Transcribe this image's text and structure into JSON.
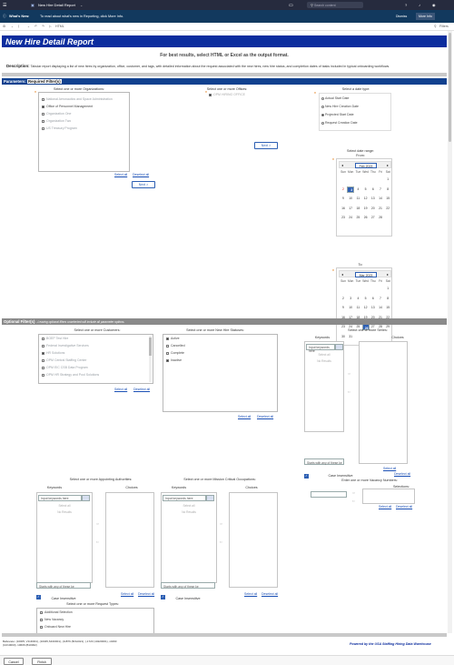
{
  "topbar": {
    "doc_title": "New Hire Detail Report",
    "search_placeholder": "Search content"
  },
  "banner": {
    "label": "What's New:",
    "text": "To read about what's new in Reporting, click More Info.",
    "dismiss": "Dismiss",
    "more": "More Info"
  },
  "toolbar": {
    "html": "HTML",
    "filters": "Filters"
  },
  "report": {
    "title": "New Hire Detail Report",
    "note": "For best results, select HTML or Excel as the output format.",
    "desc_label": "Description:",
    "desc_text": "Tabular report displaying a list of new hires by organization, office, customer, and tags, with detailed information about the request associated with the new hires, new hire status, and completion dates of tasks included in typical onboarding workflows."
  },
  "params": {
    "label": "Parameters:",
    "required": "Required Filter(s)"
  },
  "orgs": {
    "caption": "Select one or more Organizations:",
    "items": [
      "National Aeronautics and Space Administration",
      "Office of Personnel Management",
      "Organization One",
      "Organization Two",
      "US Treasury Program"
    ],
    "select_all": "Select all",
    "deselect_all": "Deselect all",
    "next": "Next >"
  },
  "offices": {
    "caption": "Select one or more Offices:",
    "item": "OPM HIRING OFFICE",
    "next": "Next >"
  },
  "datetype": {
    "caption": "Select a date type:",
    "options": [
      "Actual Start Date",
      "New Hire Creation Date",
      "Projected Start Date",
      "Request Creation Date"
    ],
    "range": "Select date range:",
    "from": "From:",
    "to": "To:"
  },
  "cal_weekdays": [
    "Sun",
    "Mon",
    "Tue",
    "Wed",
    "Thu",
    "Fri",
    "Sat"
  ],
  "cal_from": {
    "month": "Feb 2023",
    "rows": [
      [
        "",
        "",
        "",
        "1",
        "2",
        "3",
        "4"
      ],
      [
        "5",
        "6",
        "7",
        "8",
        "9",
        "10",
        "11"
      ],
      [
        "12",
        "13",
        "14",
        "15",
        "16",
        "17",
        "18"
      ],
      [
        "19",
        "20",
        "21",
        "22",
        "23",
        "24",
        "25"
      ],
      [
        "26",
        "27",
        "28",
        "",
        "",
        "",
        ""
      ]
    ]
  },
  "cal_to": {
    "month": "Mar 2023",
    "rows": [
      [
        "",
        "",
        "",
        "1",
        "2",
        "3",
        "4"
      ],
      [
        "5",
        "6",
        "7",
        "8",
        "9",
        "10",
        "11"
      ],
      [
        "12",
        "13",
        "14",
        "15",
        "16",
        "17",
        "18"
      ],
      [
        "19",
        "20",
        "21",
        "22",
        "23",
        "24",
        "25"
      ],
      [
        "26",
        "27",
        "28",
        "29",
        "30",
        "31",
        ""
      ]
    ]
  },
  "cal_from_disp": {
    "month": "Feb 2023",
    "rows": [
      [
        "",
        "",
        "",
        "",
        "",
        "",
        "1"
      ],
      [
        "2",
        "3",
        "4",
        "5",
        "6",
        "7",
        "8"
      ],
      [
        "9",
        "10",
        "11",
        "12",
        "13",
        "14",
        "15"
      ],
      [
        "16",
        "17",
        "18",
        "19",
        "20",
        "21",
        "22"
      ],
      [
        "23",
        "24",
        "25",
        "26",
        "27",
        "28",
        ""
      ]
    ]
  },
  "cal_to_disp": {
    "month": "Mar 2023",
    "rows": [
      [
        "",
        "",
        "",
        "",
        "",
        "",
        "1"
      ],
      [
        "2",
        "3",
        "4",
        "5",
        "6",
        "7",
        "8"
      ],
      [
        "9",
        "10",
        "11",
        "12",
        "13",
        "14",
        "15"
      ],
      [
        "16",
        "17",
        "18",
        "19",
        "20",
        "21",
        "22"
      ],
      [
        "23",
        "24",
        "25",
        "26",
        "27",
        "28",
        "29"
      ],
      [
        "30",
        "31",
        "",
        "",
        "",
        "",
        ""
      ]
    ]
  },
  "optional": {
    "label": "Optional Filter(s)",
    "note": "- Leaving optional filters unselected will include all parameter options."
  },
  "customers": {
    "caption": "Select one or more Customers:",
    "items": [
      "BOEP Test Hire",
      "Federal Investigative Services",
      "HR Solutions",
      "OPM Central Staffing Center",
      "OPM EIC CSB Data Program",
      "OPM HR Strategy and Pool Solutions"
    ],
    "select_all": "Select all",
    "deselect_all": "Deselect all"
  },
  "statuses": {
    "caption": "Select one or more New Hire Statuses:",
    "items": [
      "Active",
      "Cancelled",
      "Complete",
      "Inactive"
    ],
    "select_all": "Select all",
    "deselect_all": "Deselect all"
  },
  "series": {
    "caption": "Select one or more Series:",
    "keywords": "Keywords",
    "choices": "Choices",
    "placeholder": "Input keywords here",
    "select_all_inner": "Select all",
    "no_results": "No Results",
    "starts": "Starts with any of these ke",
    "select_all": "Select all",
    "deselect_all": "Deselect all",
    "case": "Case Insensitive"
  },
  "authorities": {
    "caption": "Select one or more Appointing Authorities:",
    "keywords": "Keywords",
    "choices": "Choices",
    "placeholder": "Input keywords here",
    "select_all_inner": "Select all",
    "no_results": "No Results",
    "starts": "Starts with any of these ke",
    "select_all": "Select all",
    "deselect_all": "Deselect all",
    "case": "Case Insensitive"
  },
  "occupations": {
    "caption": "Select one or more Mission Critical Occupations:",
    "keywords": "Keywords",
    "choices": "Choices",
    "placeholder": "Input keywords here",
    "select_all_inner": "Select all",
    "no_results": "No Results",
    "starts": "Starts with any of these ke",
    "select_all": "Select all",
    "deselect_all": "Deselect all",
    "case": "Case Insensitive"
  },
  "vacancy": {
    "caption": "Enter one or more Vacancy Numbers:",
    "selections": "Selections:",
    "select_all": "Select all",
    "deselect_all": "Deselect all"
  },
  "reqtypes": {
    "caption": "Select one or more Request Types:",
    "items": [
      "Additional Selection",
      "New Vacancy",
      "Onboard New Hire"
    ],
    "select_all": "Select all",
    "deselect_all": "Deselect all"
  },
  "footer": {
    "text1": "Bellevieto: (10005, V11D001), (10045,SF40001), (11876 (B/1A021), (-1723 (10220001), v0290",
    "text2": "(10/10003), 10606 (B10002)",
    "powered": "Powered by the USA Staffing Hiring Data Warehouse"
  },
  "buttons": {
    "cancel": "Cancel",
    "finish": "Finish"
  },
  "colors": {
    "title": "#0c2d9e",
    "required": "#11418f",
    "accent": "#2d5fb3"
  }
}
